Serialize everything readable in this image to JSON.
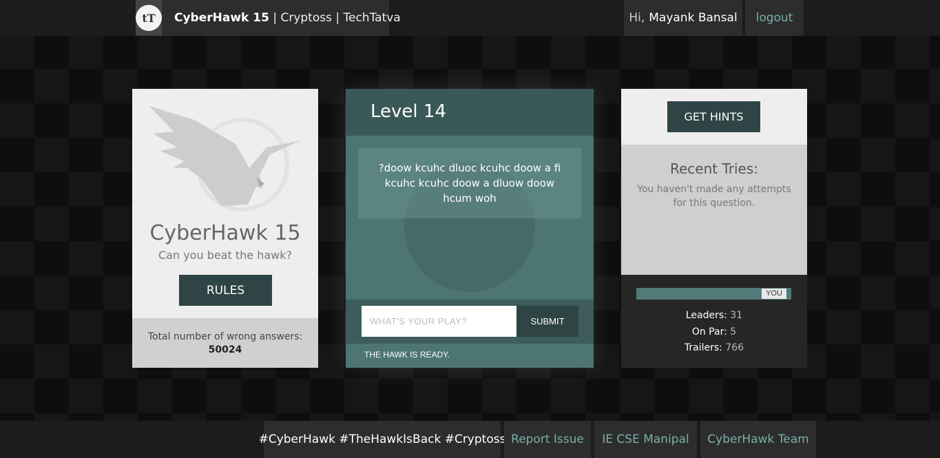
{
  "header": {
    "logo_text": "tT",
    "brand_name": "CyberHawk 15",
    "brand_rest": " | Cryptoss | TechTatva",
    "greeting": "Hi,",
    "user_name": "Mayank Bansal",
    "logout_label": "logout"
  },
  "left_card": {
    "title": "CyberHawk 15",
    "subtitle": "Can you beat the hawk?",
    "rules_label": "RULES",
    "wrong_label": "Total number of wrong answers:",
    "wrong_count": "50024"
  },
  "level_card": {
    "title": "Level 14",
    "puzzle_text": "?doow kcuhc dluoc kcuhc doow a fi kcuhc kcuhc doow a dluow doow hcum woh",
    "answer_placeholder": "WHAT'S YOUR PLAY?",
    "answer_value": "",
    "submit_label": "SUBMIT",
    "status_text": "THE HAWK IS READY."
  },
  "right_card": {
    "hints_label": "GET HINTS",
    "recent_title": "Recent Tries:",
    "recent_text": "You haven't made any attempts for this question.",
    "you_label": "YOU",
    "progress_position": 0.97,
    "leaders_label": "Leaders:",
    "leaders_value": "31",
    "onpar_label": "On Par:",
    "onpar_value": "5",
    "trailers_label": "Trailers:",
    "trailers_value": "766"
  },
  "footer": {
    "tags": "#CyberHawk #TheHawkIsBack #Cryptoss",
    "links": [
      "Report Issue",
      "IE CSE Manipal",
      "CyberHawk Team"
    ]
  },
  "colors": {
    "accent_dark": "#2f4444",
    "accent_teal": "#4c7574",
    "link": "#7ab0aa"
  },
  "icons": [
    "techtatva-logo-icon",
    "hawk-emblem-icon"
  ]
}
